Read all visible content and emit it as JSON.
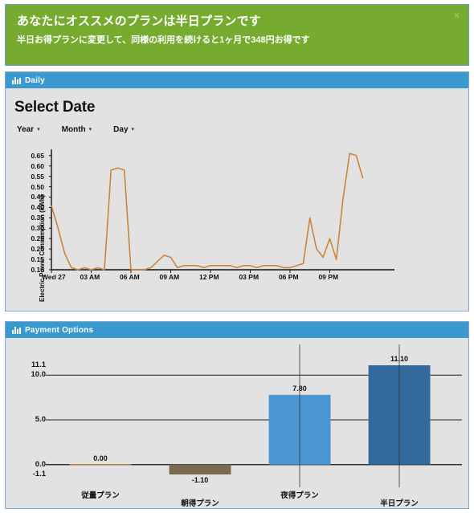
{
  "banner": {
    "title": "あなたにオススメのプランは半日プランです",
    "subtitle": "半日お得プランに変更して、同様の利用を続けると1ヶ月で348円お得です",
    "close_label": "×",
    "background_color": "#76ab30",
    "text_color": "#ffffff"
  },
  "panels": {
    "daily": {
      "header_title": "Daily",
      "header_icon": "bar-chart-icon",
      "header_color": "#3a9ad0",
      "section_title": "Select Date",
      "selectors": [
        {
          "label": "Year",
          "caret": "▾"
        },
        {
          "label": "Month",
          "caret": "▾"
        },
        {
          "label": "Day",
          "caret": "▾"
        }
      ]
    },
    "payment": {
      "header_title": "Payment Options",
      "header_icon": "bar-chart-icon",
      "header_color": "#3a9ad0"
    }
  },
  "chart_data": [
    {
      "type": "line",
      "title": "Select Date",
      "xlabel": "",
      "ylabel": "Electric Power Consumption (kWh)",
      "ylim": [
        0.1,
        0.68
      ],
      "yticks": [
        0.1,
        0.15,
        0.2,
        0.25,
        0.3,
        0.35,
        0.4,
        0.45,
        0.5,
        0.55,
        0.6,
        0.65
      ],
      "ytick_labels": [
        "0.10",
        "0.15",
        "0.20",
        "0.25",
        "0.30",
        "0.35",
        "0.40",
        "0.45",
        "0.50",
        "0.55",
        "0.60",
        "0.65"
      ],
      "xtick_labels": [
        "Wed 27",
        "03 AM",
        "06 AM",
        "09 AM",
        "12 PM",
        "03 PM",
        "06 PM",
        "09 PM"
      ],
      "grid": false,
      "line_color": "#c8853f",
      "series": [
        {
          "name": "Electric Power Consumption",
          "x": [
            "00:00",
            "00:30",
            "01:00",
            "01:30",
            "02:00",
            "02:30",
            "03:00",
            "03:30",
            "04:00",
            "04:30",
            "05:00",
            "05:30",
            "06:00",
            "06:30",
            "07:00",
            "07:30",
            "08:00",
            "08:30",
            "09:00",
            "09:30",
            "10:00",
            "10:30",
            "11:00",
            "11:30",
            "12:00",
            "12:30",
            "13:00",
            "13:30",
            "14:00",
            "14:30",
            "15:00",
            "15:30",
            "16:00",
            "16:30",
            "17:00",
            "17:30",
            "18:00",
            "18:30",
            "19:00",
            "19:30",
            "20:00",
            "20:30",
            "21:00",
            "21:30",
            "22:00",
            "22:30",
            "23:00",
            "23:30"
          ],
          "values": [
            0.41,
            0.3,
            0.18,
            0.11,
            0.1,
            0.11,
            0.1,
            0.11,
            0.1,
            0.58,
            0.59,
            0.58,
            0.1,
            0.1,
            0.1,
            0.11,
            0.14,
            0.17,
            0.16,
            0.11,
            0.12,
            0.12,
            0.12,
            0.11,
            0.12,
            0.12,
            0.12,
            0.12,
            0.11,
            0.12,
            0.12,
            0.11,
            0.12,
            0.12,
            0.12,
            0.11,
            0.11,
            0.12,
            0.13,
            0.35,
            0.2,
            0.16,
            0.25,
            0.15,
            0.44,
            0.66,
            0.65,
            0.54
          ]
        }
      ]
    },
    {
      "type": "bar",
      "title": "Payment Options",
      "xlabel": "",
      "ylabel": "",
      "ylim": [
        -1.1,
        11.1
      ],
      "yticks": [
        -1.1,
        0.0,
        5.0,
        10.0,
        11.1
      ],
      "ytick_labels": [
        "-1.1",
        "0.0",
        "5.0",
        "10.0",
        "11.1"
      ],
      "grid": true,
      "categories": [
        "従量プラン",
        "朝得プラン",
        "夜得プラン",
        "半日プラン"
      ],
      "values": [
        0.0,
        -1.1,
        7.8,
        11.1
      ],
      "value_labels": [
        "0.00",
        "-1.10",
        "7.80",
        "11.10"
      ],
      "colors": [
        "#c8853f",
        "#7a6a4f",
        "#4a96d2",
        "#336a9c"
      ]
    }
  ]
}
